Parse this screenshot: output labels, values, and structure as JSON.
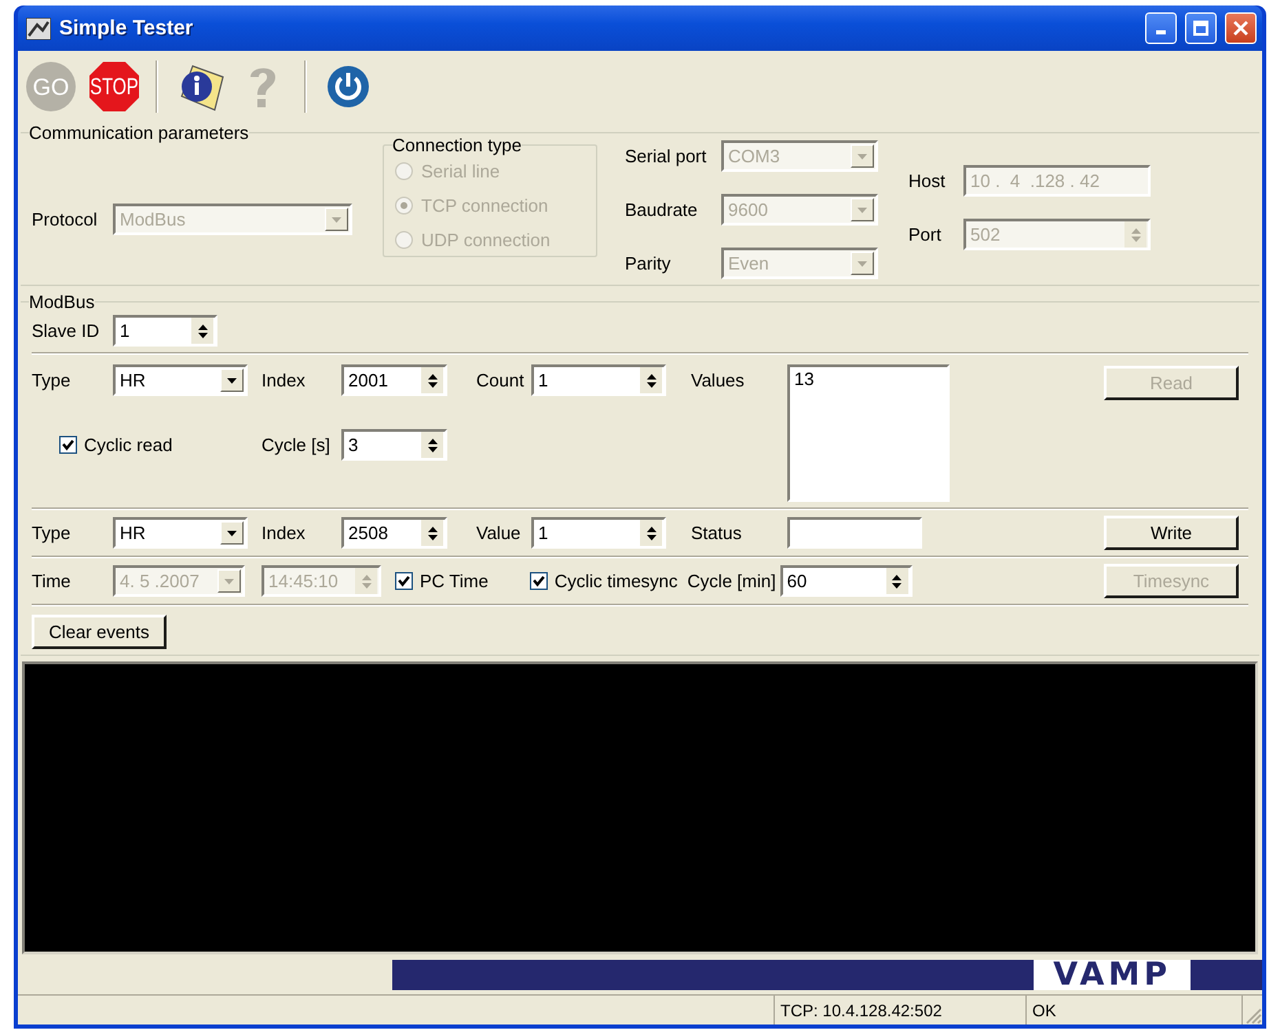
{
  "window": {
    "title": "Simple Tester"
  },
  "toolbar": {
    "buttons": [
      {
        "kind": "go",
        "label": "GO",
        "disabled": true
      },
      {
        "kind": "stop",
        "label": "STOP",
        "disabled": false
      },
      {
        "kind": "info",
        "disabled": false
      },
      {
        "kind": "help",
        "disabled": true
      },
      {
        "kind": "power",
        "disabled": false
      }
    ]
  },
  "communication": {
    "legend": "Communication parameters",
    "protocol": {
      "label": "Protocol",
      "value": "ModBus",
      "disabled": true
    },
    "connection_type": {
      "legend": "Connection type",
      "options": [
        {
          "label": "Serial line",
          "selected": false,
          "disabled": true
        },
        {
          "label": "TCP connection",
          "selected": true,
          "disabled": true
        },
        {
          "label": "UDP connection",
          "selected": false,
          "disabled": true
        }
      ]
    },
    "serial_port": {
      "label": "Serial port",
      "value": "COM3",
      "disabled": true
    },
    "baudrate": {
      "label": "Baudrate",
      "value": "9600",
      "disabled": true
    },
    "parity": {
      "label": "Parity",
      "value": "Even",
      "disabled": true
    },
    "host": {
      "label": "Host",
      "value": "10 .  4  .128 . 42",
      "disabled": true
    },
    "port": {
      "label": "Port",
      "value": "502",
      "disabled": true
    }
  },
  "modbus": {
    "legend": "ModBus",
    "slave_id": {
      "label": "Slave ID",
      "value": "1"
    },
    "read": {
      "type": {
        "label": "Type",
        "value": "HR"
      },
      "index": {
        "label": "Index",
        "value": "2001"
      },
      "count": {
        "label": "Count",
        "value": "1"
      },
      "values_label": "Values",
      "values": [
        "13"
      ],
      "read_button": {
        "label": "Read",
        "disabled": true
      },
      "cyclic_read": {
        "label": "Cyclic read",
        "checked": true
      },
      "cycle": {
        "label": "Cycle [s]",
        "value": "3"
      }
    },
    "write": {
      "type": {
        "label": "Type",
        "value": "HR"
      },
      "index": {
        "label": "Index",
        "value": "2508"
      },
      "value": {
        "label": "Value",
        "value": "1"
      },
      "status_label": "Status",
      "write_button": {
        "label": "Write",
        "disabled": false
      }
    },
    "time": {
      "label": "Time",
      "date": {
        "value": "4. 5 .2007",
        "disabled": true
      },
      "clock": {
        "value": "14:45:10",
        "disabled": true
      },
      "pc_time": {
        "label": "PC Time",
        "checked": true
      },
      "cyclic_timesync": {
        "label": "Cyclic timesync",
        "checked": true
      },
      "cycle": {
        "label": "Cycle [min]",
        "value": "60"
      },
      "timesync_button": {
        "label": "Timesync",
        "disabled": true
      }
    },
    "clear_events": {
      "label": "Clear events"
    }
  },
  "brand": {
    "logo": "VAMP"
  },
  "status_bar": {
    "panels": [
      {
        "text": "TCP: 10.4.128.42:502"
      },
      {
        "text": "OK"
      }
    ]
  }
}
